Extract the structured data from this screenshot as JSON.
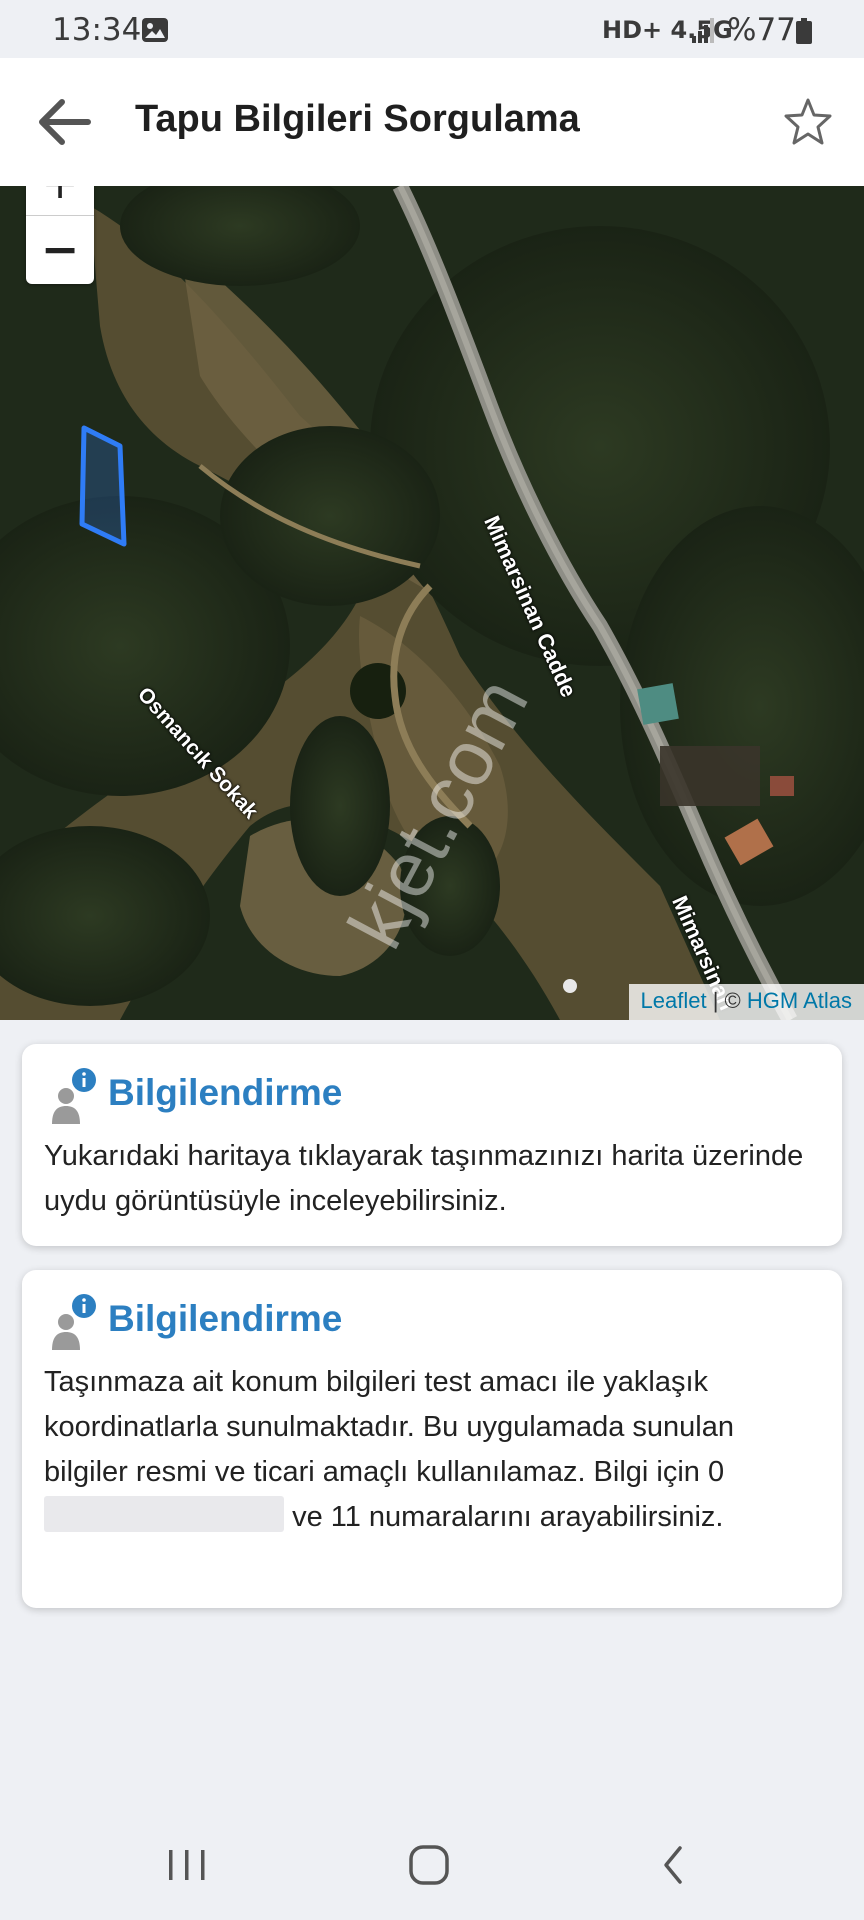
{
  "status_bar": {
    "time": "13:34",
    "network": "HD+ 4.5G",
    "battery": "%77",
    "icons": [
      "gallery-icon",
      "signal-icon",
      "battery-icon"
    ]
  },
  "app_bar": {
    "title": "Tapu Bilgileri Sorgulama",
    "back_icon": "arrow-left-icon",
    "favorite_icon": "star-outline-icon"
  },
  "map": {
    "zoom_in": "+",
    "zoom_out": "−",
    "streets": [
      "Mimarsinan Cadde",
      "Osmancık Sokak",
      "Mimarsinan"
    ],
    "watermark": "kjet.com",
    "attribution": {
      "leaflet": "Leaflet",
      "separator": " | © ",
      "provider": "HGM Atlas"
    },
    "parcel_color": "#2f7cf6"
  },
  "cards": [
    {
      "title": "Bilgilendirme",
      "body": "Yukarıdaki haritaya tıklayarak taşınmazınızı harita üzerinde uydu görüntüsüyle inceleyebilirsiniz."
    },
    {
      "title": "Bilgilendirme",
      "body_before": "Taşınmaza ait konum bilgileri test amacı ile yaklaşık koordinatlarla sunulmaktadır. Bu uygulamada sunulan bilgiler resmi ve ticari amaçlı kullanılamaz. Bilgi için 0",
      "body_after": "ve 11 numaralarını arayabilirsiniz."
    }
  ],
  "colors": {
    "accent": "#2c7fc1",
    "background": "#eef0f4"
  }
}
